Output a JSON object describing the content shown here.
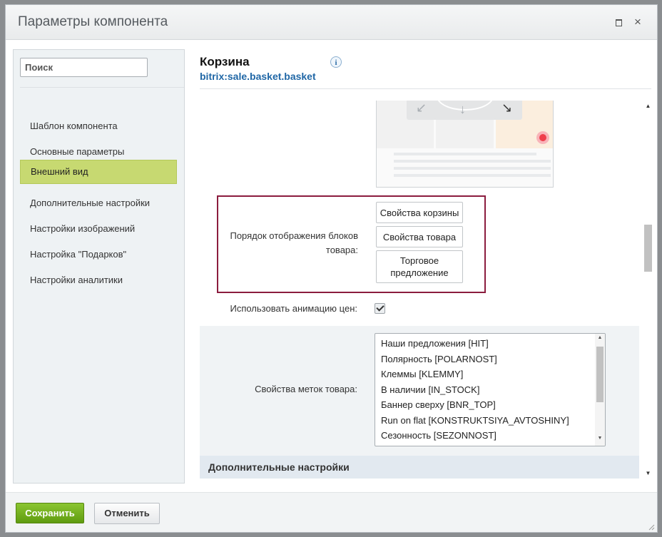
{
  "window": {
    "title": "Параметры компонента",
    "maximize_icon": "maximize-icon",
    "close_icon": "close-icon",
    "close_glyph": "×"
  },
  "sidebar": {
    "search_placeholder": "Поиск",
    "items": [
      {
        "label": "Шаблон компонента",
        "active": false
      },
      {
        "label": "Основные параметры",
        "active": false
      },
      {
        "label": "Внешний вид",
        "active": true
      },
      {
        "label": "Дополнительные настройки",
        "active": false
      },
      {
        "label": "Настройки изображений",
        "active": false
      },
      {
        "label": "Настройка \"Подарков\"",
        "active": false
      },
      {
        "label": "Настройки аналитики",
        "active": false
      }
    ]
  },
  "component": {
    "title": "Корзина",
    "code": "bitrix:sale.basket.basket",
    "info_glyph": "i"
  },
  "params": {
    "order_label": "Порядок отображения блоков товара:",
    "order_buttons": [
      "Свойства корзины",
      "Свойства товара",
      "Торговое предложение"
    ],
    "animation_label": "Использовать анимацию цен:",
    "animation_checked": true,
    "labels_label": "Свойства меток товара:",
    "labels_options": [
      "Наши предложения [HIT]",
      "Полярность [POLARNOST]",
      "Клеммы [KLEMMY]",
      "В наличии [IN_STOCK]",
      "Баннер сверху [BNR_TOP]",
      "Run on flat [KONSTRUKTSIYA_AVTOSHINY]",
      "Сезонность [SEZONNOST]"
    ],
    "section_title": "Дополнительные настройки"
  },
  "footer": {
    "save_label": "Сохранить",
    "cancel_label": "Отменить"
  },
  "colors": {
    "active_nav": "#c7d971",
    "link_blue": "#2067a6",
    "highlight_border": "#8b1c3e",
    "save_green": "#6fae1e"
  }
}
